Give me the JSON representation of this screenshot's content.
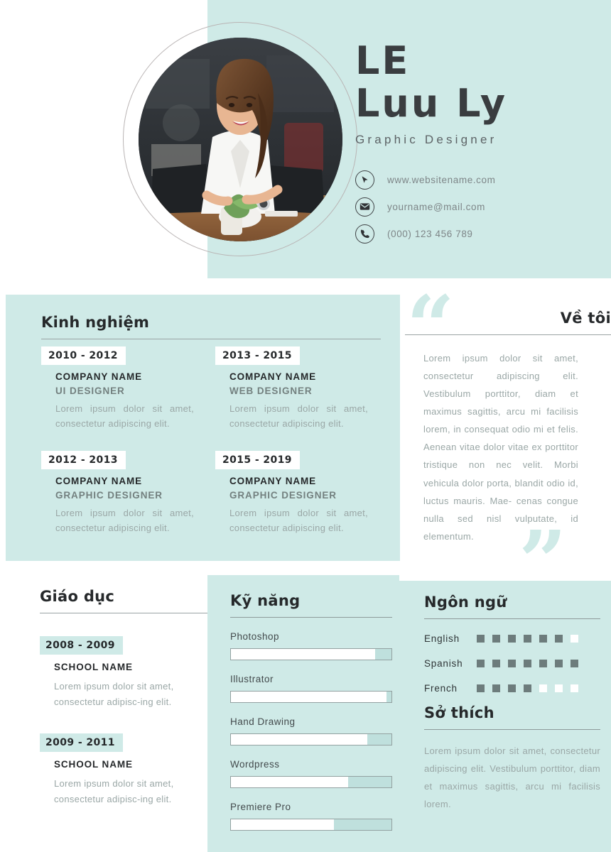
{
  "header": {
    "name_line1": "LE",
    "name_line2": "Luu Ly",
    "role": "Graphic Designer",
    "contacts": [
      {
        "icon": "cursor-icon",
        "text": "www.websitename.com"
      },
      {
        "icon": "envelope-icon",
        "text": "yourname@mail.com"
      },
      {
        "icon": "phone-icon",
        "text": "(000) 123 456 789"
      }
    ]
  },
  "experience": {
    "title": "Kinh nghiệm",
    "items": [
      {
        "dates": "2010 - 2012",
        "company": "COMPANY NAME",
        "job_title": "UI DESIGNER",
        "description": "Lorem ipsum dolor sit amet, consectetur adipiscing elit."
      },
      {
        "dates": "2013 - 2015",
        "company": "COMPANY NAME",
        "job_title": "WEB DESIGNER",
        "description": "Lorem ipsum dolor sit amet, consectetur adipiscing elit."
      },
      {
        "dates": "2012 - 2013",
        "company": "COMPANY NAME",
        "job_title": "GRAPHIC DESIGNER",
        "description": "Lorem ipsum dolor sit amet, consectetur adipiscing elit."
      },
      {
        "dates": "2015 - 2019",
        "company": "COMPANY NAME",
        "job_title": "GRAPHIC DESIGNER",
        "description": "Lorem ipsum dolor sit amet, consectetur adipiscing elit."
      }
    ]
  },
  "about": {
    "title": "Về tôi",
    "quote_open": "“",
    "quote_close": "”",
    "text": "Lorem ipsum dolor sit amet, consectetur adipiscing elit. Vestibulum porttitor, diam et maximus sagittis, arcu mi facilisis lorem, in consequat odio mi et felis. Aenean vitae dolor vitae ex porttitor tristique non nec velit. Morbi vehicula dolor porta, blandit odio id, luctus mauris. Mae- cenas congue nulla sed nisl vulputate, id elementum."
  },
  "education": {
    "title": "Giáo dục",
    "items": [
      {
        "dates": "2008 - 2009",
        "school": "SCHOOL NAME",
        "description": "Lorem ipsum dolor sit amet, consectetur adipisc-ing elit."
      },
      {
        "dates": "2009 - 2011",
        "school": "SCHOOL NAME",
        "description": "Lorem ipsum dolor sit amet, consectetur adipisc-ing elit."
      }
    ]
  },
  "skills": {
    "title": "Kỹ năng",
    "items": [
      {
        "name": "Photoshop",
        "level": 90
      },
      {
        "name": "Illustrator",
        "level": 97
      },
      {
        "name": "Hand Drawing",
        "level": 85
      },
      {
        "name": "Wordpress",
        "level": 73
      },
      {
        "name": "Premiere Pro",
        "level": 64
      }
    ]
  },
  "languages": {
    "title": "Ngôn ngữ",
    "total_boxes": 7,
    "items": [
      {
        "name": "English",
        "filled": 6
      },
      {
        "name": "Spanish",
        "filled": 7
      },
      {
        "name": "French",
        "filled": 4
      }
    ]
  },
  "hobbies": {
    "title": "Sở thích",
    "text": "Lorem ipsum dolor sit amet, consectetur adipiscing elit. Vestibulum porttitor, diam et maximus sagittis, arcu mi facilisis lorem."
  },
  "colors": {
    "mint": "#cfeae7",
    "dark": "#26292b",
    "muted": "#9aa7a6"
  }
}
